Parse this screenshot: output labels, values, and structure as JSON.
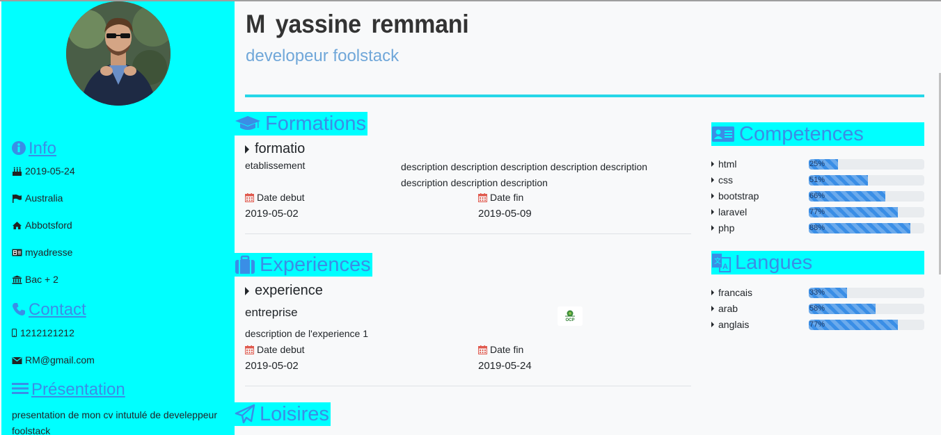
{
  "profile": {
    "name": "M  yassine  remmani",
    "title": "developeur foolstack"
  },
  "sidebar": {
    "info_title": "Info",
    "info_items": [
      {
        "icon": "birthday-cake-icon",
        "text": "2019-05-24"
      },
      {
        "icon": "flag-icon",
        "text": "Australia"
      },
      {
        "icon": "home-icon",
        "text": "Abbotsford"
      },
      {
        "icon": "address-card-icon",
        "text": "myadresse"
      },
      {
        "icon": "university-icon",
        "text": "Bac + 2"
      }
    ],
    "contact_title": "Contact",
    "contact_items": [
      {
        "icon": "mobile-icon",
        "text": "1212121212"
      },
      {
        "icon": "envelope-icon",
        "text": "RM@gmail.com"
      }
    ],
    "presentation_title": "Présentation",
    "presentation_text": "presentation de mon cv intutulé de develeppeur foolstack"
  },
  "formations": {
    "title": "Formations",
    "items": [
      {
        "name": "formatio",
        "etablissement": "etablissement",
        "description": "description description description description description description description description",
        "date_debut_label": "Date debut",
        "date_debut": "2019-05-02",
        "date_fin_label": "Date fin",
        "date_fin": "2019-05-09"
      }
    ]
  },
  "experiences": {
    "title": "Experiences",
    "items": [
      {
        "name": "experience",
        "entreprise": "entreprise",
        "logo_text": "OCP",
        "description": "description de l'experience 1",
        "date_debut_label": "Date debut",
        "date_debut": "2019-05-02",
        "date_fin_label": "Date fin",
        "date_fin": "2019-05-24"
      }
    ]
  },
  "loisires": {
    "title": "Loisires"
  },
  "competences": {
    "title": "Competences",
    "items": [
      {
        "name": "html",
        "percent": 25,
        "label": "25%"
      },
      {
        "name": "css",
        "percent": 51,
        "label": "51%"
      },
      {
        "name": "bootstrap",
        "percent": 66,
        "label": "66%"
      },
      {
        "name": "laravel",
        "percent": 77,
        "label": "77%"
      },
      {
        "name": "php",
        "percent": 88,
        "label": "88%"
      }
    ]
  },
  "langues": {
    "title": "Langues",
    "items": [
      {
        "name": "francais",
        "percent": 33,
        "label": "33%"
      },
      {
        "name": "arab",
        "percent": 58,
        "label": "58%"
      },
      {
        "name": "anglais",
        "percent": 77,
        "label": "77%"
      }
    ]
  },
  "colors": {
    "sidebar_bg": "#00ffff",
    "accent_blue": "#3a8ee6",
    "subtitle_blue": "#70a7d9",
    "divider_cyan": "#26d7e8",
    "calendar_red": "#e05a4f"
  }
}
